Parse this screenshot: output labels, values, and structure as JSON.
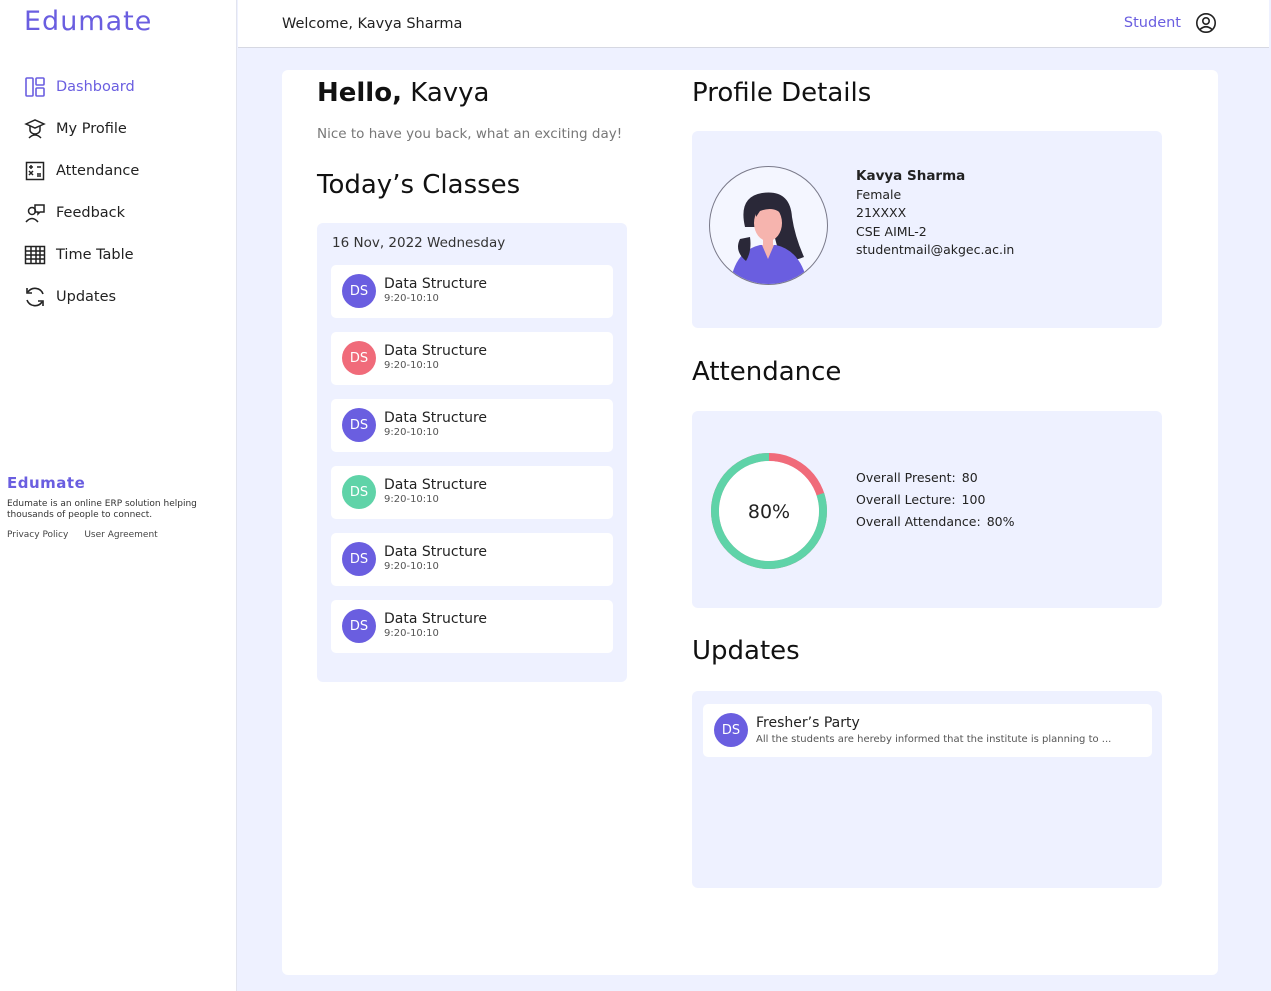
{
  "sidebar": {
    "brand": "Edumate",
    "items": [
      {
        "label": "Dashboard",
        "icon": "dashboard-icon",
        "active": true
      },
      {
        "label": "My Profile",
        "icon": "graduate-icon"
      },
      {
        "label": "Attendance",
        "icon": "calculator-icon"
      },
      {
        "label": "Feedback",
        "icon": "feedback-icon"
      },
      {
        "label": "Time Table",
        "icon": "table-icon"
      },
      {
        "label": "Updates",
        "icon": "refresh-icon"
      }
    ],
    "footer": {
      "brand": "Edumate",
      "description": "Edumate is an online ERP solution helping thousands of people to connect.",
      "privacy": "Privacy Policy",
      "agreement": "User Agreement"
    }
  },
  "header": {
    "welcome": "Welcome, Kavya Sharma",
    "role": "Student",
    "user_icon": "user-circle-icon"
  },
  "greeting": {
    "hello": "Hello,",
    "name": "Kavya",
    "tagline": "Nice to have you back, what an exciting day!"
  },
  "classes": {
    "title": "Today’s Classes",
    "date": "16 Nov, 2022 Wednesday",
    "items": [
      {
        "initials": "DS",
        "name": "Data Structure",
        "time": "9:20-10:10",
        "color": "#6a5ee0"
      },
      {
        "initials": "DS",
        "name": "Data Structure",
        "time": "9:20-10:10",
        "color": "#f06b7a"
      },
      {
        "initials": "DS",
        "name": "Data Structure",
        "time": "9:20-10:10",
        "color": "#6a5ee0"
      },
      {
        "initials": "DS",
        "name": "Data Structure",
        "time": "9:20-10:10",
        "color": "#5fd3a8"
      },
      {
        "initials": "DS",
        "name": "Data Structure",
        "time": "9:20-10:10",
        "color": "#6a5ee0"
      },
      {
        "initials": "DS",
        "name": "Data Structure",
        "time": "9:20-10:10",
        "color": "#6a5ee0"
      }
    ]
  },
  "profile": {
    "title": "Profile Details",
    "name": "Kavya Sharma",
    "gender": "Female",
    "roll": "21XXXX",
    "branch": "CSE AIML-2",
    "email": "studentmail@akgec.ac.in"
  },
  "attendance": {
    "title": "Attendance",
    "percent_label": "80%",
    "fraction_present": 0.8,
    "present_label": "Overall Present:",
    "present_value": "80",
    "lecture_label": "Overall Lecture:",
    "lecture_value": "100",
    "attendance_label": "Overall Attendance:",
    "attendance_value": "80%",
    "present_color": "#5fd3a8",
    "absent_color": "#f06b7a"
  },
  "updates": {
    "title": "Updates",
    "items": [
      {
        "initials": "DS",
        "title": "Fresher’s Party",
        "desc": "All the students are hereby informed that the institute is planning to ...",
        "color": "#6a5ee0"
      }
    ]
  },
  "colors": {
    "accent": "#6a5ee0",
    "panel_bg": "#eef1ff"
  }
}
